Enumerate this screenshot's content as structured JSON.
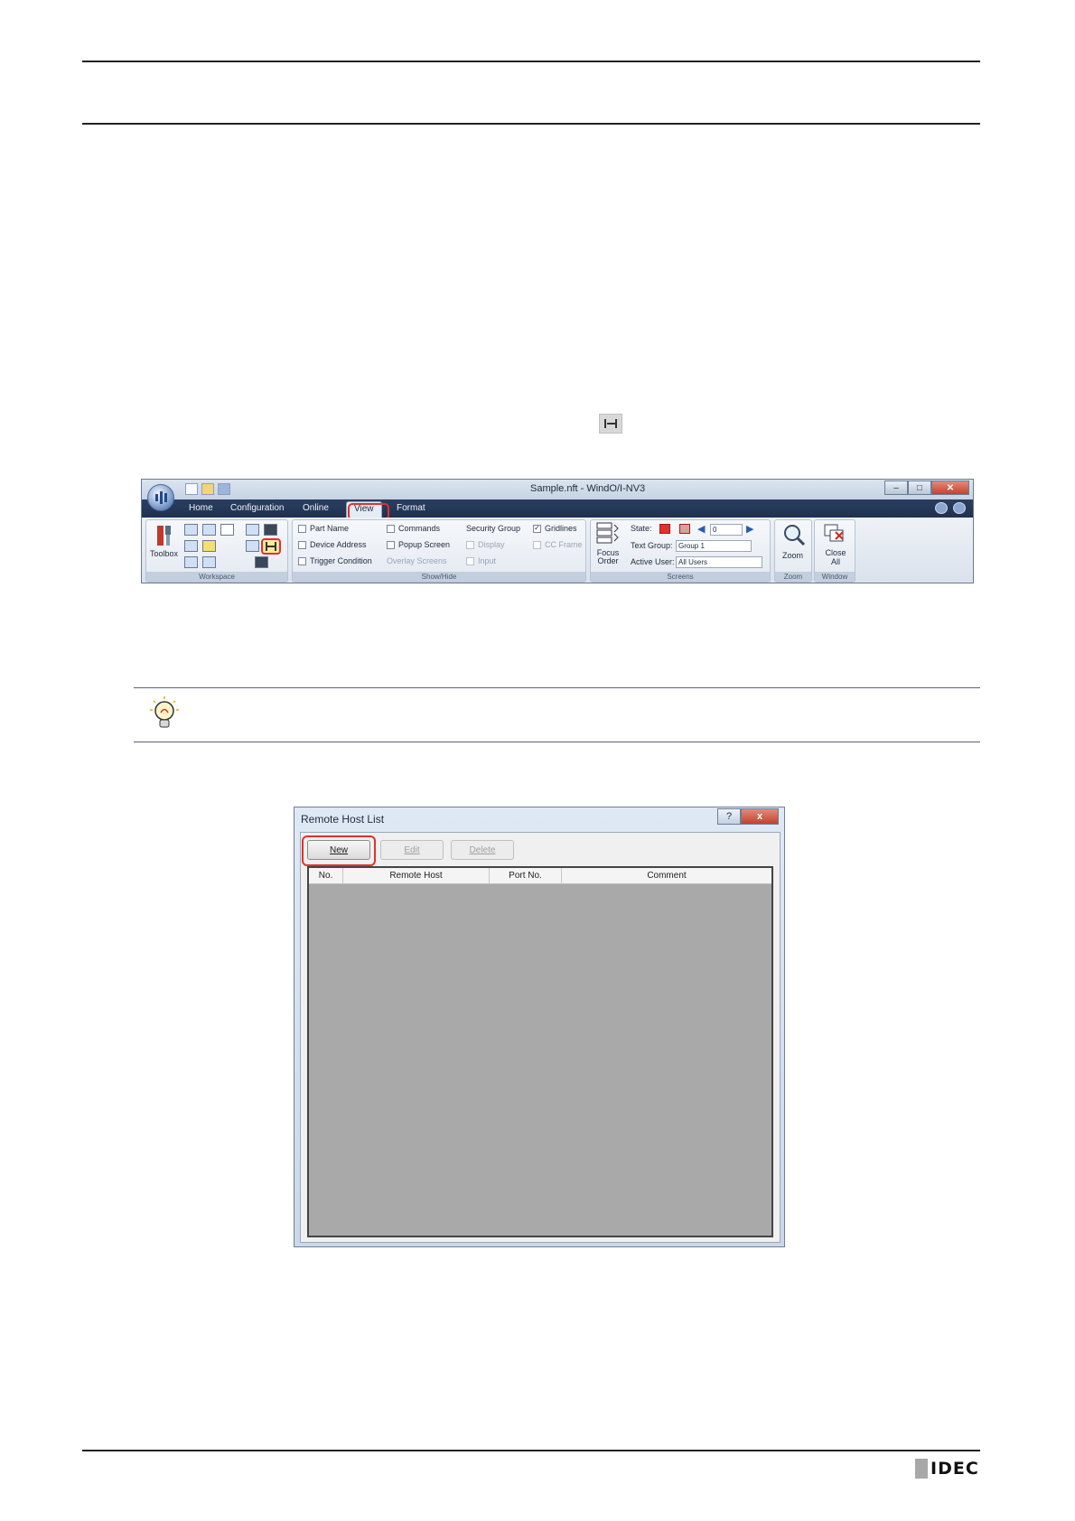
{
  "ribbon": {
    "window_title": "Sample.nft - WindO/I-NV3",
    "tabs": [
      "Home",
      "Configuration",
      "Online",
      "View",
      "Format"
    ],
    "active_tab": "View",
    "groups": {
      "workspace": {
        "label": "Workspace",
        "toolbox_label": "Toolbox"
      },
      "show_hide": {
        "label": "Show/Hide",
        "checkboxes": [
          {
            "label": "Part Name",
            "checked": false,
            "enabled": true
          },
          {
            "label": "Device Address",
            "checked": false,
            "enabled": true
          },
          {
            "label": "Trigger Condition",
            "checked": false,
            "enabled": true
          },
          {
            "label": "Commands",
            "checked": false,
            "enabled": true
          },
          {
            "label": "Popup Screen",
            "checked": false,
            "enabled": true
          },
          {
            "label": "Display",
            "checked": false,
            "enabled": false
          },
          {
            "label": "Input",
            "checked": false,
            "enabled": false
          },
          {
            "label": "Gridlines",
            "checked": true,
            "enabled": true
          },
          {
            "label": "CC Frame",
            "checked": false,
            "enabled": false
          }
        ],
        "overlay_label": "Overlay Screens",
        "security_label": "Security Group"
      },
      "screens": {
        "label": "Screens",
        "focus_order_label": "Focus Order",
        "state_label": "State:",
        "state_value": "0",
        "text_group_label": "Text Group:",
        "text_group_value": "Group 1",
        "active_user_label": "Active User:",
        "active_user_value": "All Users"
      },
      "zoom": {
        "label": "Zoom",
        "button_label": "Zoom"
      },
      "window": {
        "label": "Window",
        "close_all_label": "Close All"
      }
    }
  },
  "dialog": {
    "title": "Remote Host List",
    "help_glyph": "?",
    "close_glyph": "x",
    "buttons": {
      "new": "New",
      "edit": "Edit",
      "delete": "Delete"
    },
    "columns": [
      "No.",
      "Remote Host",
      "Port No.",
      "Comment"
    ]
  },
  "logo": {
    "text": "IDEC"
  },
  "colors": {
    "highlight": "#e0322a",
    "list_bg": "#a9a9a9"
  }
}
